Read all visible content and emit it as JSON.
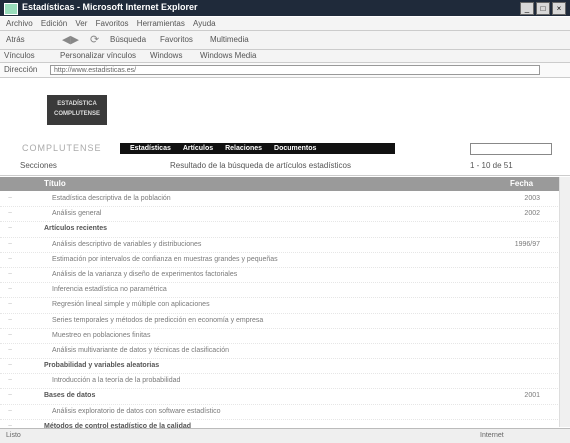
{
  "window": {
    "title": "Estadísticas - Microsoft Internet Explorer"
  },
  "menu": [
    "Archivo",
    "Edición",
    "Ver",
    "Favoritos",
    "Herramientas",
    "Ayuda"
  ],
  "toolbar": {
    "back": "Atrás",
    "search": "Búsqueda",
    "favorites": "Favoritos",
    "media": "Multimedia"
  },
  "links": [
    "Vínculos",
    "Personalizar vínculos",
    "Windows",
    "Windows Media"
  ],
  "address": {
    "label": "Dirección",
    "url": "http://www.estadisticas.es/"
  },
  "header": {
    "logo_line1": "ESTADÍSTICA",
    "logo_line2": "COMPLUTENSE"
  },
  "nav": {
    "brand": "COMPLUTENSE",
    "items": [
      "Estadísticas",
      "Artículos",
      "Relaciones",
      "Documentos"
    ]
  },
  "subbar": {
    "label": "Secciones",
    "title": "Resultado de la búsqueda de artículos estadísticos",
    "pager": "1 - 10 de 51"
  },
  "table": {
    "headers": [
      "Título",
      "Fecha"
    ],
    "rows": [
      {
        "text": "Estadística descriptiva de la población",
        "date": "2003"
      },
      {
        "text": "Análisis general",
        "date": "2002"
      },
      {
        "text": "Artículos recientes",
        "date": "",
        "level": 1
      },
      {
        "text": "Análisis descriptivo de variables y distribuciones",
        "date": "1996/97"
      },
      {
        "text": "Estimación por intervalos de confianza en muestras grandes y pequeñas",
        "date": ""
      },
      {
        "text": "Análisis de la varianza y diseño de experimentos factoriales",
        "date": ""
      },
      {
        "text": "Inferencia estadística no paramétrica",
        "date": ""
      },
      {
        "text": "Regresión lineal simple y múltiple con aplicaciones",
        "date": ""
      },
      {
        "text": "Series temporales y métodos de predicción en economía y empresa",
        "date": ""
      },
      {
        "text": "Muestreo en poblaciones finitas",
        "date": ""
      },
      {
        "text": "Análisis multivariante de datos y técnicas de clasificación",
        "date": ""
      },
      {
        "text": "Probabilidad y variables aleatorias",
        "date": "",
        "level": 1
      },
      {
        "text": "Introducción a la teoría de la probabilidad",
        "date": ""
      },
      {
        "text": "Bases de datos",
        "date": "2001",
        "level": 1
      },
      {
        "text": "Análisis exploratorio de datos con software estadístico",
        "date": ""
      },
      {
        "text": "Métodos de control estadístico de la calidad",
        "date": "",
        "level": 1
      }
    ]
  },
  "status": {
    "text": "Listo",
    "zone": "Internet"
  }
}
